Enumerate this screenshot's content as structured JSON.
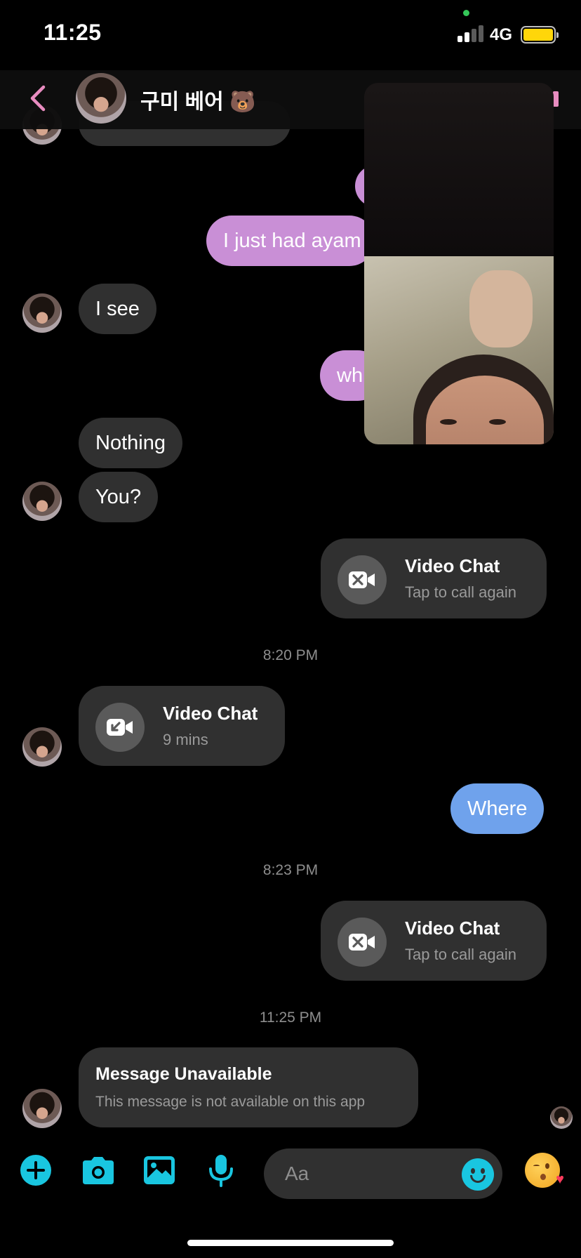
{
  "status": {
    "time": "11:25",
    "network": "4G"
  },
  "header": {
    "contact_name": "구미 베어 🐻"
  },
  "messages": {
    "m1": "I just had ayam",
    "m2": "I see",
    "m3": "wh",
    "m4": "Nothing",
    "m5": "You?",
    "m6": "Where"
  },
  "calls": {
    "c1": {
      "title": "Video Chat",
      "subtitle": "Tap to call again",
      "type": "missed-outgoing"
    },
    "c2": {
      "title": "Video Chat",
      "subtitle": "9 mins",
      "type": "incoming"
    },
    "c3": {
      "title": "Video Chat",
      "subtitle": "Tap to call again",
      "type": "missed-outgoing"
    }
  },
  "timestamps": [
    "8:20 PM",
    "8:23 PM",
    "11:25 PM"
  ],
  "unavailable": {
    "title": "Message Unavailable",
    "subtitle": "This message is not available on this app"
  },
  "composer": {
    "placeholder": "Aa"
  },
  "colors": {
    "accent": "#19c6e0",
    "outgoing_pink": "#c98fd6",
    "outgoing_blue": "#6fa2ec",
    "incoming": "#303030",
    "back_arrow": "#e88cc0"
  }
}
